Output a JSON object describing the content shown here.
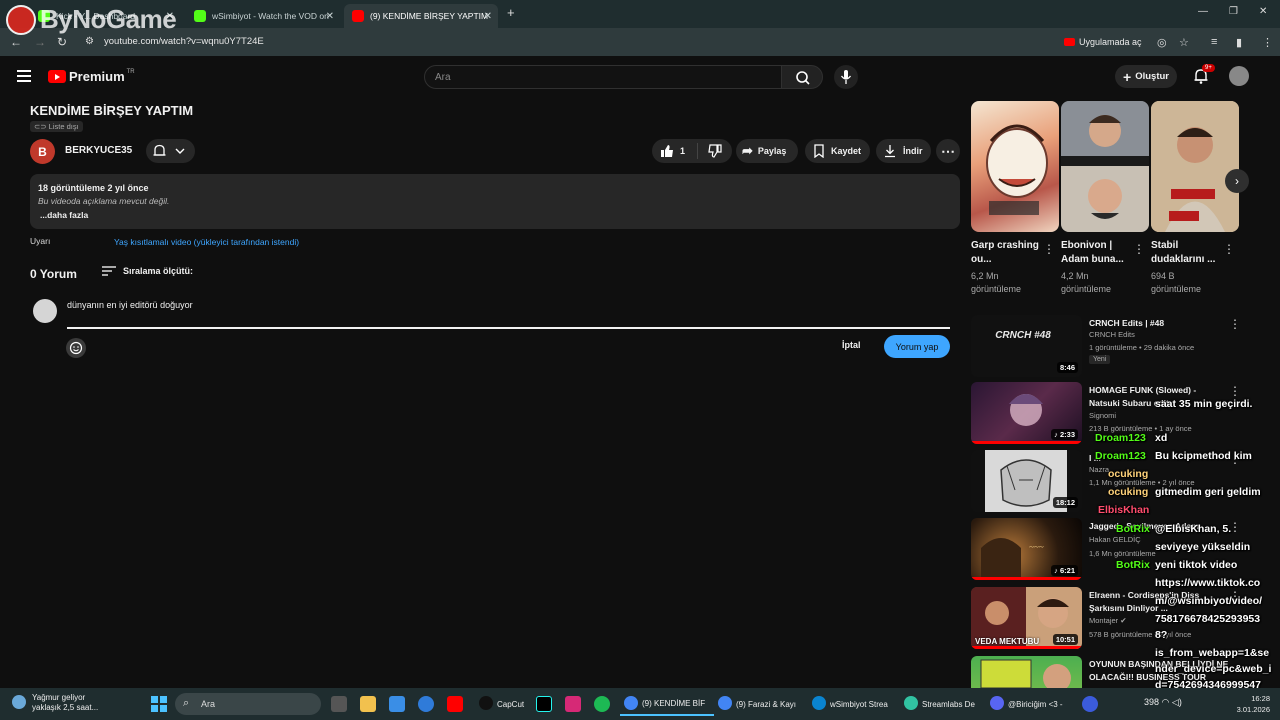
{
  "browser": {
    "tabs": [
      {
        "label": "Kick - Y... Dashboard",
        "color": "#53fc18"
      },
      {
        "label": "wSimbiyot - Watch the VOD on",
        "color": "#53fc18"
      },
      {
        "label": "(9) KENDİME BİRŞEY YAPTIM -",
        "color": "#ff0000"
      }
    ],
    "url": "youtube.com/watch?v=wqnu0Y7T24E",
    "open_in_app": "Uygulamada aç",
    "watermark": "ByNoGame"
  },
  "youtube": {
    "logo_text": "Premium",
    "region": "TR",
    "search_placeholder": "Ara",
    "create_label": "Oluştur",
    "notif_count": "9+"
  },
  "video": {
    "title": "KENDİME BİRŞEY YAPTIM",
    "privacy": "Liste dışı",
    "channel_initial": "B",
    "channel_name": "BERKYUCE35",
    "like_count": "1",
    "share_label": "Paylaş",
    "save_label": "Kaydet",
    "download_label": "İndir",
    "views_date": "18 görüntüleme  2 yıl önce",
    "no_description": "Bu videoda açıklama mevcut değil.",
    "more_label": "...daha fazla",
    "warning_label": "Uyarı",
    "warning_text": "Yaş kısıtlamalı video (yükleyici tarafından istendi)"
  },
  "comments": {
    "count": "0 Yorum",
    "sort_label": "Sıralama ölçütü:",
    "draft": "dünyanın en iyi editörü doğuyor",
    "cancel": "İptal",
    "submit": "Yorum yap"
  },
  "shorts": [
    {
      "title": "Garp crashing ou...",
      "views": "6,2 Mn görüntüleme"
    },
    {
      "title": "Ebonivon | Adam buna...",
      "views": "4,2 Mn görüntüleme"
    },
    {
      "title": "Stabil dudaklarını ...",
      "views": "694 B görüntüleme"
    }
  ],
  "related": [
    {
      "title": "CRNCH Edits | #48",
      "channel": "CRNCH Edits",
      "meta": "1 görüntüleme • 29 dakika önce",
      "duration": "8:46",
      "badge": "Yeni",
      "thumb_text": "CRNCH #48"
    },
    {
      "title": "HOMAGE FUNK (Slowed) - Natsuki Subaru edit",
      "channel": "Signomi",
      "meta": "213 B görüntüleme • 1 ay önce",
      "duration": "2:33"
    },
    {
      "title": "I ... ",
      "channel": "Nazra",
      "meta": "1,1 Mn görüntüleme • 2 yıl önce",
      "duration": "18:12"
    },
    {
      "title": "Jagged - Sevilmeyen Adam",
      "channel": "Hakan GELDİÇ",
      "meta": "1,6 Mn görüntüleme",
      "duration": "6:21"
    },
    {
      "title": "Elraenn - Cordiseps'in Diss Şarkısını Dinliyor ...",
      "channel": "Montajer",
      "meta": "578 B görüntüleme • 2 yıl önce",
      "duration": "10:51",
      "thumb_text": "VEDA MEKTUBU"
    },
    {
      "title": "OYUNUN BAŞINDAN BELLİYDİ NE OLACAĞI!! BUSINESS TOUR",
      "channel": "",
      "meta": "",
      "duration": ""
    }
  ],
  "chat": [
    {
      "user": "",
      "msg": "saat 35 min geçirdi."
    },
    {
      "user": "Droam123",
      "msg": "xd"
    },
    {
      "user": "Droam123",
      "msg": "Bu kcipmethod kim"
    },
    {
      "user": "ocuking",
      "msg": ""
    },
    {
      "user": "ocuking",
      "msg": "gitmedim geri geldim"
    },
    {
      "user": "ElbisKhan",
      "msg": ""
    },
    {
      "user": "BotRix",
      "msg": "@ElbisKhan, 5."
    },
    {
      "user": "",
      "msg": "seviyeye yükseldin"
    },
    {
      "user": "BotRix",
      "msg": "yeni tiktok video"
    },
    {
      "user": "",
      "msg": "https://www.tiktok.co"
    },
    {
      "user": "",
      "msg": "m/@wsimbiyot/video/"
    },
    {
      "user": "",
      "msg": "758176678425293953"
    },
    {
      "user": "",
      "msg": "8?"
    },
    {
      "user": "",
      "msg": "is_from_webapp=1&se"
    },
    {
      "user": "",
      "msg": "nder_device=pc&web_i"
    },
    {
      "user": "",
      "msg": "d=7542694346999547"
    }
  ],
  "taskbar": {
    "weather_title": "Yağmur geliyor",
    "weather_sub": "yaklaşık 2,5 saat...",
    "search": "Ara",
    "apps": [
      {
        "label": "CapCut",
        "color": "#111111"
      },
      {
        "label": "(9) KENDİME BİF",
        "color": "#4285f4"
      },
      {
        "label": "(9) Farazi & Kayı",
        "color": "#4285f4"
      },
      {
        "label": "wSimbiyot Strea",
        "color": "#0a84d0"
      },
      {
        "label": "Streamlabs De",
        "color": "#31c3a2"
      },
      {
        "label": "@Biriciğim <3 -",
        "color": "#5865f2"
      }
    ],
    "tray_count": "398",
    "time": "16:28",
    "date": "3.01.2026"
  }
}
